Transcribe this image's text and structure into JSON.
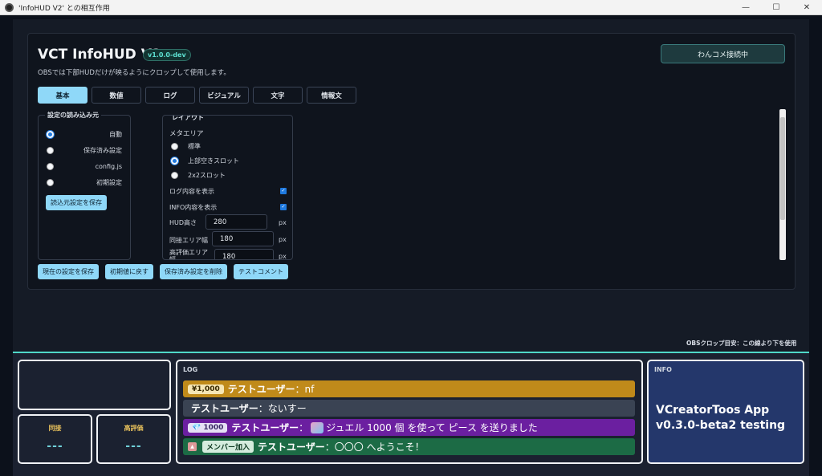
{
  "window": {
    "title": "'InfoHUD V2' との相互作用",
    "minimize": "—",
    "maximize": "☐",
    "close": "✕"
  },
  "header": {
    "title": "VCT InfoHUD V2",
    "version": "v1.0.0-dev",
    "subtitle": "OBSでは下部HUDだけが映るようにクロップして使用します。",
    "connection_button": "わんコメ接続中"
  },
  "tabs": [
    {
      "label": "基本",
      "active": true
    },
    {
      "label": "数値"
    },
    {
      "label": "ログ"
    },
    {
      "label": "ビジュアル"
    },
    {
      "label": "文字"
    },
    {
      "label": "情報文"
    }
  ],
  "source_group": {
    "legend": "設定の読み込み元",
    "options": [
      {
        "label": "自動",
        "selected": true
      },
      {
        "label": "保存済み設定",
        "selected": false
      },
      {
        "label": "config.js",
        "selected": false
      },
      {
        "label": "初期設定",
        "selected": false
      }
    ],
    "save_button": "読込元設定を保存"
  },
  "layout_group": {
    "legend": "レイアウト",
    "meta_area_label": "メタエリア",
    "meta_options": [
      {
        "label": "標準",
        "selected": false
      },
      {
        "label": "上部空きスロット",
        "selected": true
      },
      {
        "label": "2x2スロット",
        "selected": false
      }
    ],
    "show_log_label": "ログ内容を表示",
    "show_info_label": "INFO内容を表示",
    "hud_height_label": "HUD高さ",
    "hud_height_value": "280",
    "concurrent_width_label": "同接エリア幅",
    "concurrent_width_value": "180",
    "rating_width_label": "高評価エリア幅",
    "rating_width_value": "180",
    "unit": "px"
  },
  "actions": {
    "save_current": "現在の設定を保存",
    "reset_default": "初期値に戻す",
    "delete_saved": "保存済み設定を削除",
    "test_comment": "テストコメント"
  },
  "crop_note": "OBSクロップ目安：この線より下を使用",
  "hud": {
    "concurrent_label": "同接",
    "concurrent_value": "---",
    "rating_label": "高評価",
    "rating_value": "---",
    "log_title": "LOG",
    "log": [
      {
        "badge": "¥1,000",
        "user": "テストユーザー",
        "sep": "：",
        "text": "nf",
        "color": "#c08a1a",
        "badge_bg": "#f6e6b5",
        "badge_fg": "#3a2a00"
      },
      {
        "badge": "",
        "user": "テストユーザー",
        "sep": "：",
        "text": "ないすー",
        "color": "#3a4353"
      },
      {
        "badge": "1000",
        "user": "テストユーザー",
        "sep": "：",
        "text": "ジュエル 1000 個 を使って ピース を送りました",
        "color": "#6b1fa0",
        "badge_bg": "#e6e0f5",
        "badge_fg": "#3a2a66"
      },
      {
        "badge": "メンバー加入",
        "user": "テストユーザー",
        "sep": "：",
        "text": "〇〇〇 へようこそ！",
        "color": "#1c6b45",
        "badge_bg": "#d4ecdd",
        "badge_fg": "#0e3a22"
      }
    ],
    "info_title": "INFO",
    "info_line1": "VCreatorToos App",
    "info_line2": "v0.3.0-beta2 testing"
  }
}
